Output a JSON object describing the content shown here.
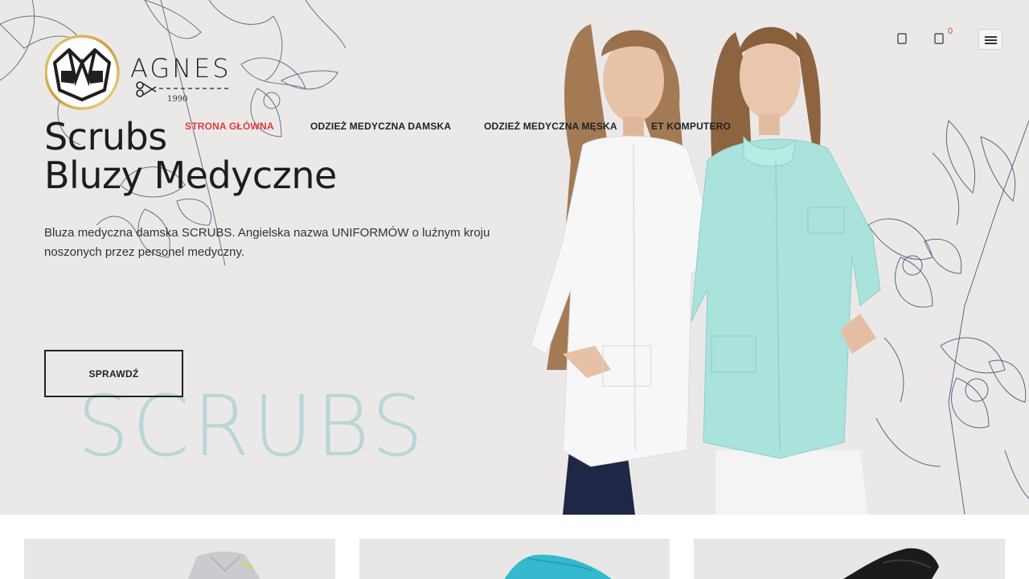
{
  "brand": {
    "name": "AGNES",
    "year": "1990"
  },
  "nav": {
    "items": [
      {
        "label": "STRONA GŁÓWNA",
        "active": true
      },
      {
        "label": "ODZIEŻ MEDYCZNA DAMSKA",
        "active": false
      },
      {
        "label": "ODZIEŻ MEDYCZNA MĘSKA",
        "active": false
      },
      {
        "label": "ET KOMPUTERO",
        "active": false
      }
    ]
  },
  "header": {
    "cart_count": "0",
    "icons": [
      "user-icon",
      "cart-icon",
      "menu-icon"
    ]
  },
  "hero": {
    "title_line1": "Scrubs",
    "title_line2": "Bluzy Medyczne",
    "description": "Bluza medyczna damska SCRUBS. Angielska nazwa UNIFORMÓW o luźnym kroju noszonych przez personel medyczny.",
    "cta_label": "SPRAWDŹ",
    "watermark": "SCRUBS"
  },
  "colors": {
    "accent": "#e2393b",
    "hero_bg": "#ebe9e8",
    "watermark": "#b8d7d6",
    "mint_uniform": "#a9e3dc",
    "white_uniform": "#f7f7f8"
  },
  "products": [
    {
      "icon": "grey-scrub-image"
    },
    {
      "icon": "turquoise-scrub-image"
    },
    {
      "icon": "black-scrub-image"
    }
  ]
}
